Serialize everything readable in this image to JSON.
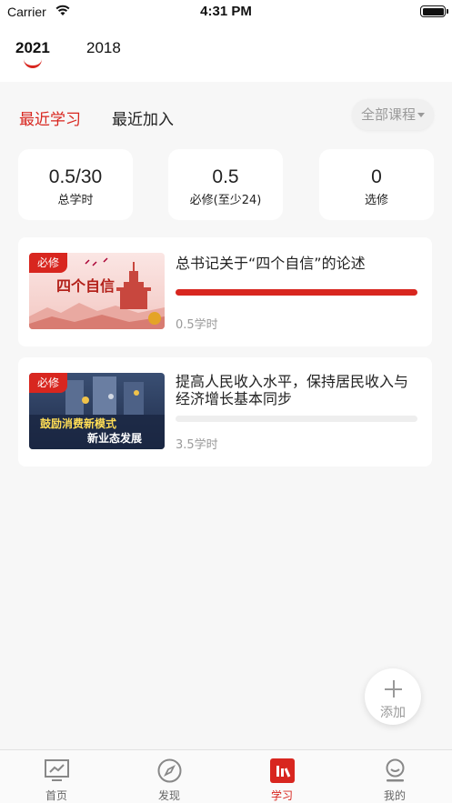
{
  "status_bar": {
    "carrier": "Carrier",
    "time": "4:31 PM"
  },
  "year_tabs": [
    {
      "label": "2021",
      "active": true
    },
    {
      "label": "2018",
      "active": false
    }
  ],
  "course_tabs": [
    {
      "label": "最近学习",
      "active": true
    },
    {
      "label": "最近加入",
      "active": false
    }
  ],
  "filter": {
    "label": "全部课程"
  },
  "stats": [
    {
      "value": "0.5/30",
      "label": "总学时"
    },
    {
      "value": "0.5",
      "label": "必修(至少24)"
    },
    {
      "value": "0",
      "label": "选修"
    }
  ],
  "courses": [
    {
      "badge": "必修",
      "title": "总书记关于“四个自信”的论述",
      "hours": "0.5学时",
      "progress": 1.0,
      "thumb_text": "四个自信"
    },
    {
      "badge": "必修",
      "title": "提高人民收入水平，保持居民收入与经济增长基本同步",
      "hours": "3.5学时",
      "progress": 0.0,
      "thumb_text_1": "鼓励消费新模式",
      "thumb_text_2": "新业态发展"
    }
  ],
  "add_button": {
    "label": "添加"
  },
  "tab_bar": [
    {
      "label": "首页",
      "icon": "home-monitor-icon",
      "active": false
    },
    {
      "label": "发现",
      "icon": "compass-icon",
      "active": false
    },
    {
      "label": "学习",
      "icon": "study-book-icon",
      "active": true
    },
    {
      "label": "我的",
      "icon": "profile-icon",
      "active": false
    }
  ],
  "colors": {
    "accent": "#d8261f",
    "background": "#f7f7f7",
    "muted": "#999999"
  }
}
